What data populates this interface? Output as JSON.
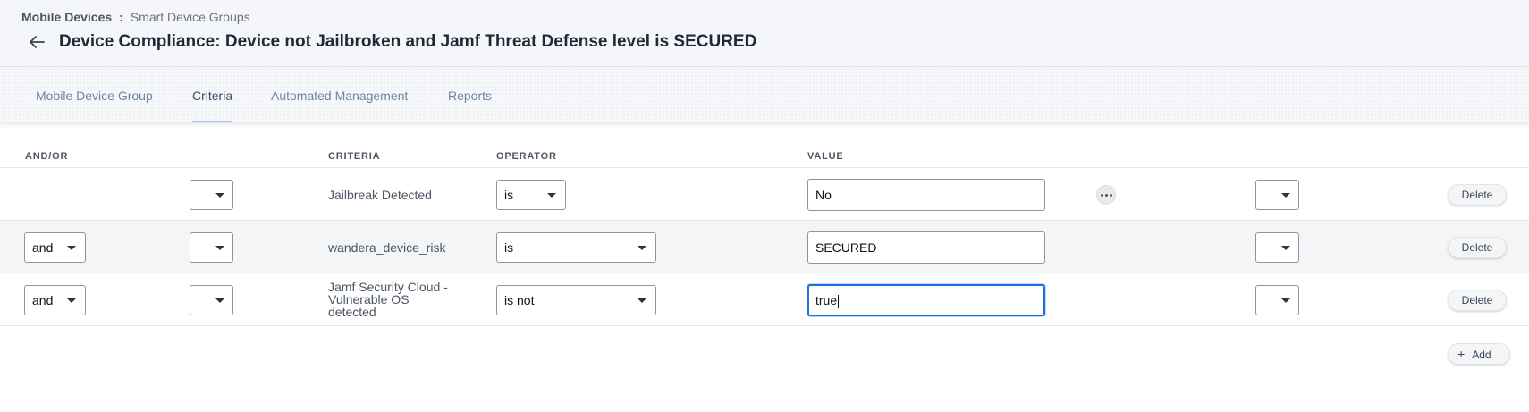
{
  "breadcrumb": {
    "parent": "Mobile Devices",
    "separator": ":",
    "current": "Smart Device Groups"
  },
  "page_title": "Device Compliance: Device not Jailbroken and Jamf Threat Defense level is SECURED",
  "tabs": [
    {
      "label": "Mobile Device Group",
      "active": false
    },
    {
      "label": "Criteria",
      "active": true
    },
    {
      "label": "Automated Management",
      "active": false
    },
    {
      "label": "Reports",
      "active": false
    }
  ],
  "columns": {
    "andor": "AND/OR",
    "criteria": "CRITERIA",
    "operator": "OPERATOR",
    "value": "VALUE"
  },
  "rows": [
    {
      "andor": "",
      "open_paren": "",
      "criteria": "Jailbreak Detected",
      "operator": "is",
      "value": "No",
      "close_paren": "",
      "delete_label": "Delete"
    },
    {
      "andor": "and",
      "open_paren": "",
      "criteria": "wandera_device_risk",
      "operator": "is",
      "value": "SECURED",
      "close_paren": "",
      "delete_label": "Delete"
    },
    {
      "andor": "and",
      "open_paren": "",
      "criteria_lines": [
        "Jamf Security Cloud -",
        "Vulnerable OS",
        "detected"
      ],
      "operator": "is not",
      "value": "true",
      "close_paren": "",
      "delete_label": "Delete"
    }
  ],
  "add_button": {
    "icon": "+",
    "label": "Add"
  },
  "icons": {
    "back": "arrow-left-icon",
    "more": "ellipsis-icon",
    "dropdown": "caret-down-icon",
    "add": "plus-icon"
  },
  "colors": {
    "focus": "#1b73d6",
    "tab_active_underline": "#a9c4e6"
  }
}
